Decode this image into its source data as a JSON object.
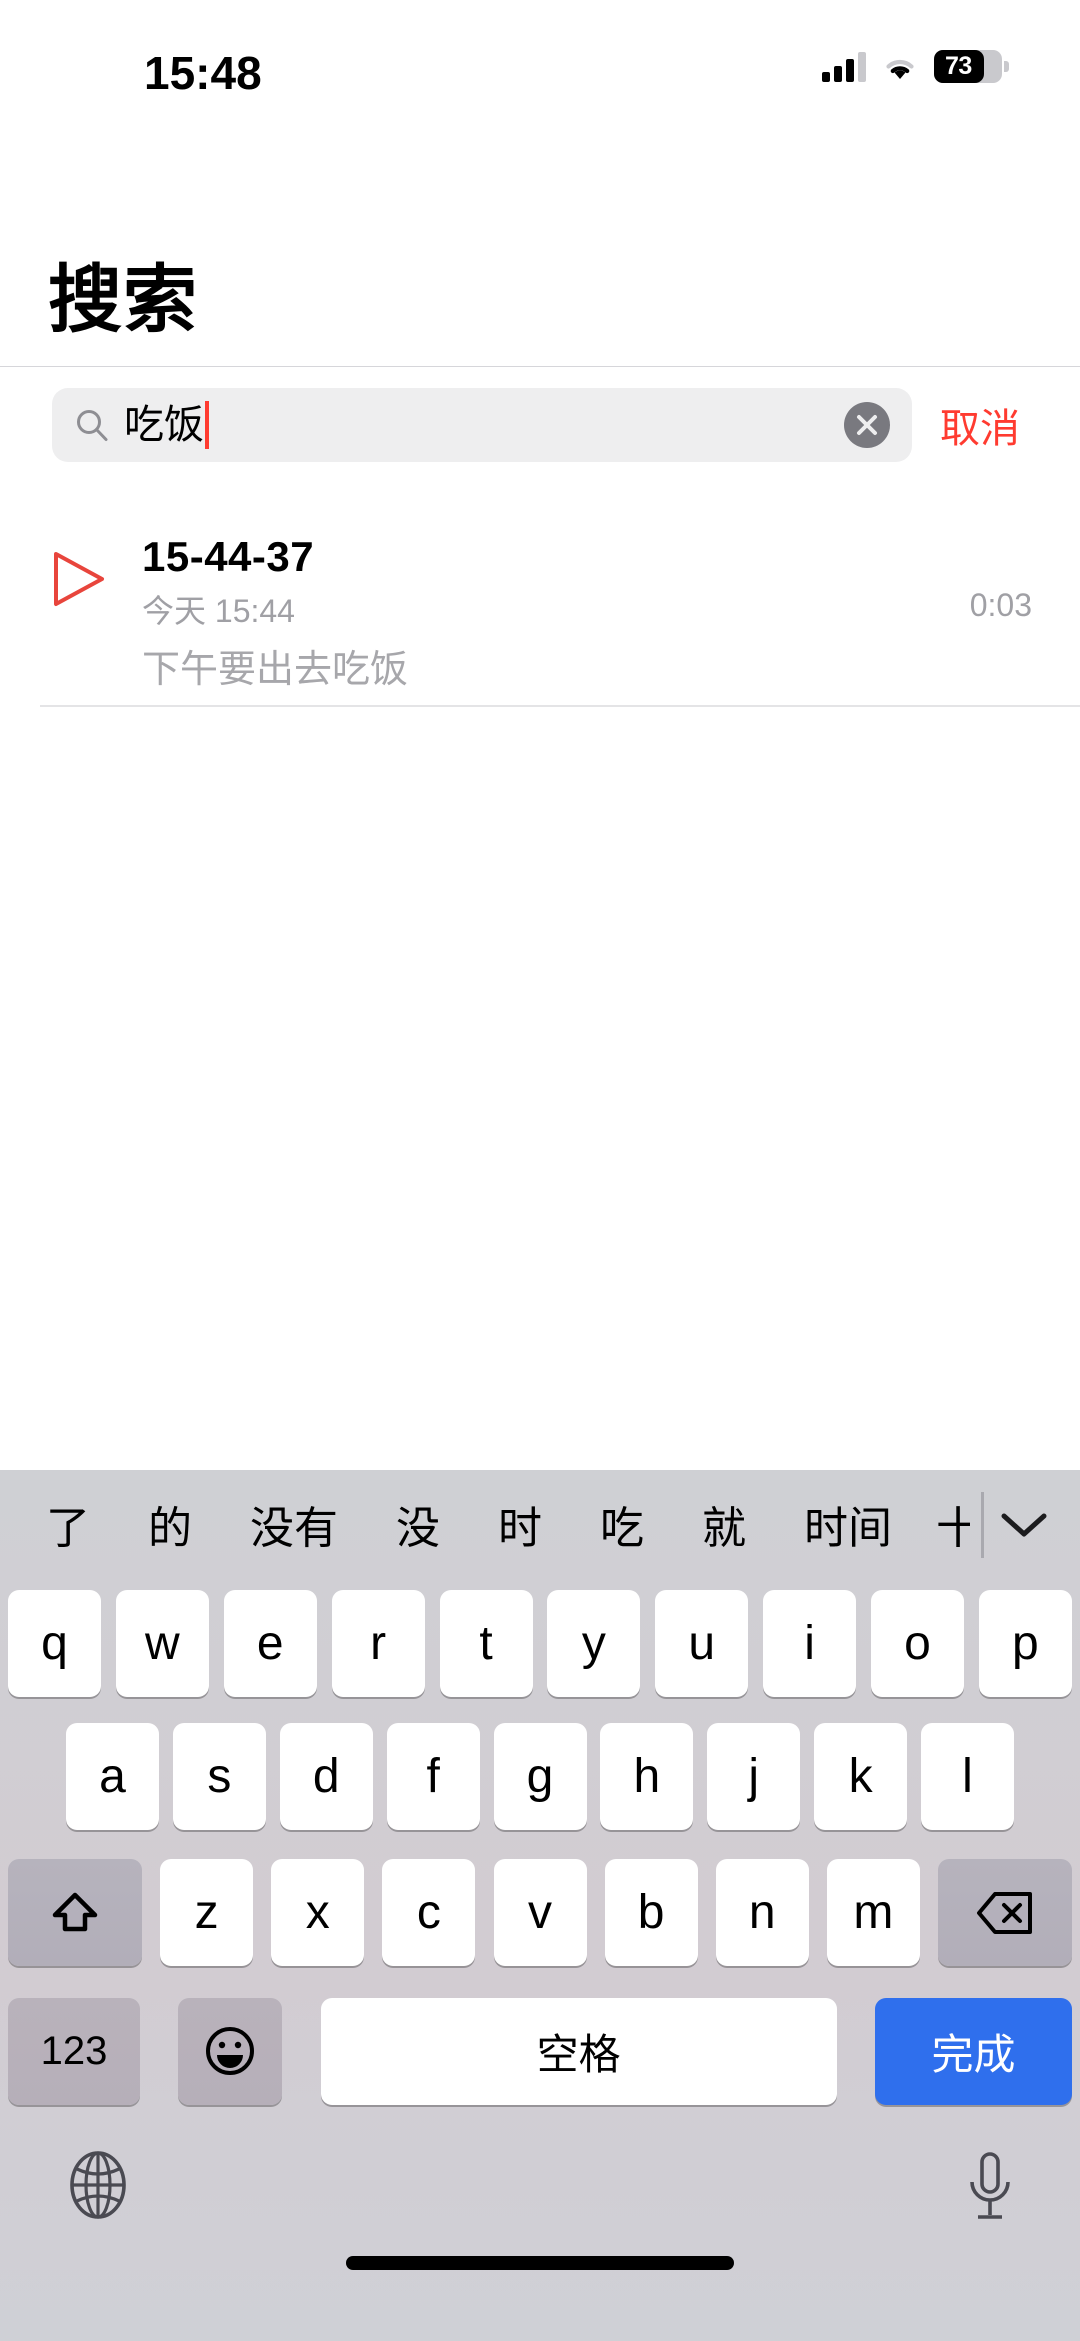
{
  "status_bar": {
    "time": "15:48",
    "signal_icon": "cellular-signal-icon",
    "signal_bars_filled": 3,
    "signal_bars_total": 4,
    "wifi_icon": "wifi-icon",
    "battery_icon": "battery-icon",
    "battery_percent": "73"
  },
  "header": {
    "title": "搜索"
  },
  "search": {
    "icon": "search-icon",
    "value": "吃饭",
    "clear_icon": "clear-circle-icon",
    "cancel_label": "取消"
  },
  "results": [
    {
      "play_icon": "play-triangle-icon",
      "title": "15-44-37",
      "subtitle": "今天 15:44",
      "duration": "0:03",
      "transcript": "下午要出去吃饭"
    }
  ],
  "keyboard": {
    "candidates": [
      "了",
      "的",
      "没有",
      "没",
      "时",
      "吃",
      "就",
      "时间"
    ],
    "candidate_truncated": "十",
    "expand_icon": "chevron-down-icon",
    "row1": [
      "q",
      "w",
      "e",
      "r",
      "t",
      "y",
      "u",
      "i",
      "o",
      "p"
    ],
    "row2": [
      "a",
      "s",
      "d",
      "f",
      "g",
      "h",
      "j",
      "k",
      "l"
    ],
    "row3": [
      "z",
      "x",
      "c",
      "v",
      "b",
      "n",
      "m"
    ],
    "shift_icon": "shift-arrow-icon",
    "delete_icon": "delete-backspace-icon",
    "numeric_label": "123",
    "emoji_icon": "emoji-smiley-icon",
    "space_label": "空格",
    "done_label": "完成",
    "globe_icon": "globe-icon",
    "mic_icon": "microphone-icon"
  },
  "colors": {
    "accent_red": "#ff3b30",
    "done_blue": "#2f6fed",
    "keyboard_bg": "#cfd0d4",
    "field_bg": "#eeeeef"
  }
}
